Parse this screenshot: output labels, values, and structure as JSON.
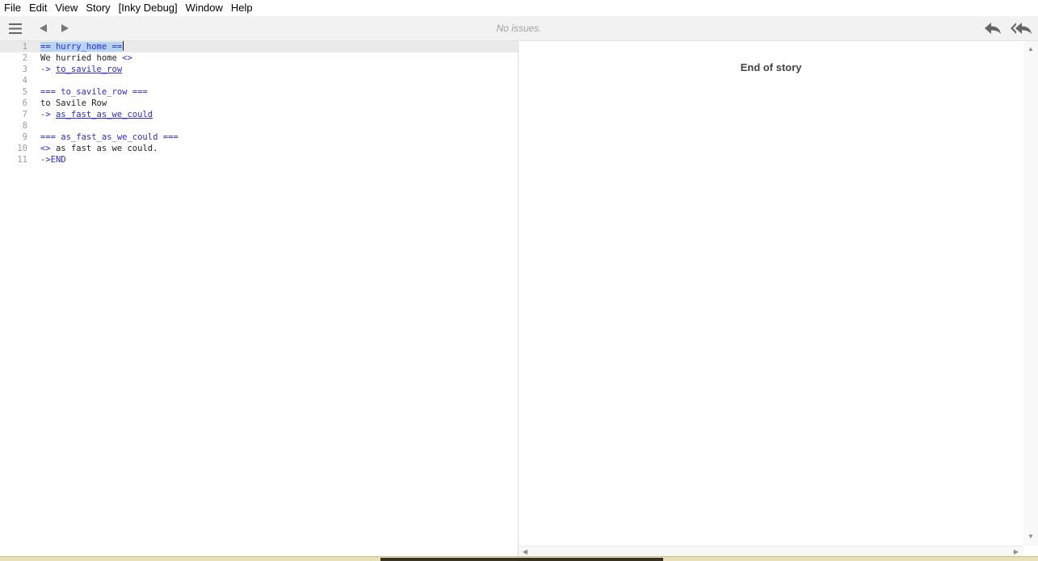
{
  "menu": [
    "File",
    "Edit",
    "View",
    "Story",
    "[Inky Debug]",
    "Window",
    "Help"
  ],
  "toolbar": {
    "status": "No issues.",
    "icons": {
      "menu": "hamburger-icon",
      "back": "triangle-left-icon",
      "forward": "triangle-right-icon",
      "undo": "reply-icon",
      "restart": "reply-all-icon"
    }
  },
  "editor": {
    "lines": [
      {
        "num": "1",
        "text": "== hurry_home =="
      },
      {
        "num": "2",
        "text": "We hurried home <>"
      },
      {
        "num": "3",
        "text": "-> to_savile_row"
      },
      {
        "num": "4",
        "text": ""
      },
      {
        "num": "5",
        "text": "=== to_savile_row ==="
      },
      {
        "num": "6",
        "text": "to Savile Row"
      },
      {
        "num": "7",
        "text": "-> as_fast_as_we_could"
      },
      {
        "num": "8",
        "text": ""
      },
      {
        "num": "9",
        "text": "=== as_fast_as_we_could ==="
      },
      {
        "num": "10",
        "text": "<> as fast as we could."
      },
      {
        "num": "11",
        "text": "->END"
      }
    ]
  },
  "player": {
    "end_text": "End of story"
  },
  "colors": {
    "keyword": "#2b2bd9",
    "selection": "#b8d3f1",
    "toolbar_bg": "#f2f2f2"
  }
}
